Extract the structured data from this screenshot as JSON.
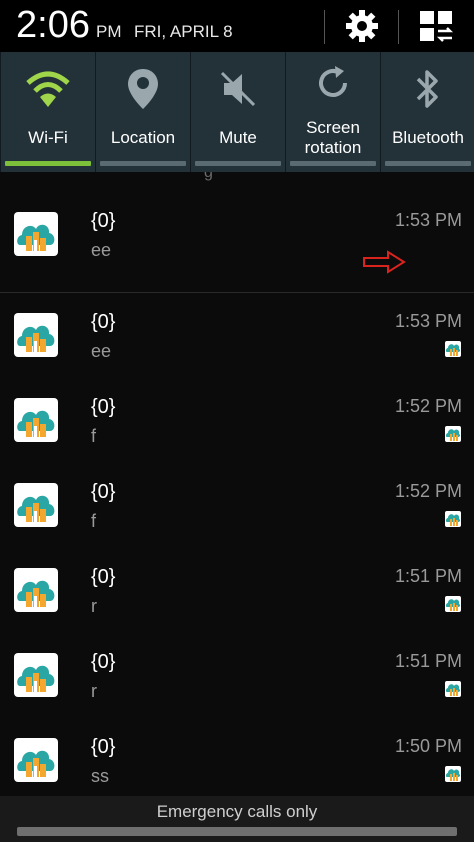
{
  "status_bar": {
    "time": "2:06",
    "ampm": "PM",
    "date": "FRI, APRIL 8",
    "icons": [
      "gear-icon",
      "grid-settings-icon"
    ]
  },
  "quick_settings": {
    "accent_on": "#7dc13a",
    "tiles": [
      {
        "label": "Wi-Fi",
        "icon": "wifi-icon",
        "on": true
      },
      {
        "label": "Location",
        "icon": "location-pin-icon",
        "on": false
      },
      {
        "label": "Mute",
        "icon": "mute-icon",
        "on": false
      },
      {
        "label_line1": "Screen",
        "label_line2": "rotation",
        "icon": "rotation-icon",
        "on": false
      },
      {
        "label": "Bluetooth",
        "icon": "bluetooth-icon",
        "on": false
      }
    ]
  },
  "notifications": [
    {
      "title": "{0}",
      "body": "ee",
      "time": "1:53 PM"
    },
    {
      "title": "{0}",
      "body": "ee",
      "time": "1:53 PM"
    },
    {
      "title": "{0}",
      "body": "f",
      "time": "1:52 PM"
    },
    {
      "title": "{0}",
      "body": "f",
      "time": "1:52 PM"
    },
    {
      "title": "{0}",
      "body": "r",
      "time": "1:51 PM"
    },
    {
      "title": "{0}",
      "body": "r",
      "time": "1:51 PM"
    },
    {
      "title": "{0}",
      "body": "ss",
      "time": "1:50 PM"
    }
  ],
  "peek_text": "g",
  "footer": {
    "emergency": "Emergency calls only"
  }
}
